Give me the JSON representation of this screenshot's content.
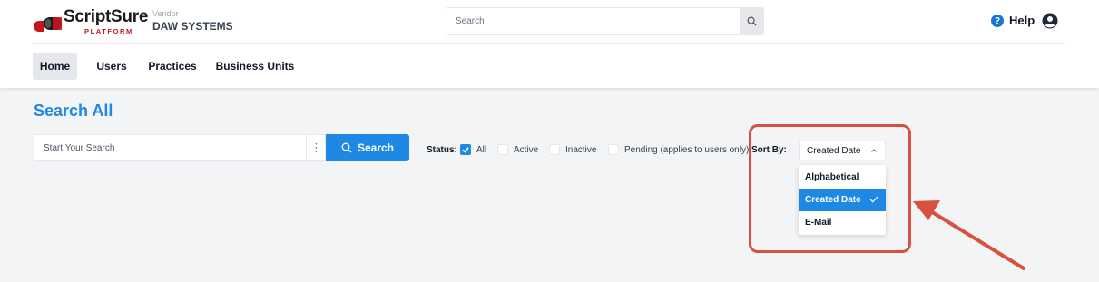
{
  "header": {
    "logo": {
      "text": "ScriptSure",
      "sub": "PLATFORM"
    },
    "vendor_label": "Vendor",
    "vendor_name": "DAW SYSTEMS",
    "search_placeholder": "Search",
    "help_label": "Help"
  },
  "nav": {
    "tabs": [
      {
        "label": "Home",
        "active": true
      },
      {
        "label": "Users",
        "active": false
      },
      {
        "label": "Practices",
        "active": false
      },
      {
        "label": "Business Units",
        "active": false
      }
    ]
  },
  "main": {
    "title": "Search All",
    "search_placeholder": "Start Your Search",
    "search_button": "Search",
    "status": {
      "label": "Status:",
      "options": [
        {
          "label": "All",
          "checked": true
        },
        {
          "label": "Active",
          "checked": false
        },
        {
          "label": "Inactive",
          "checked": false
        },
        {
          "label": "Pending (applies to users only)",
          "checked": false
        }
      ]
    },
    "sort": {
      "label": "Sort By:",
      "selected": "Created Date",
      "options": [
        "Alphabetical",
        "Created Date",
        "E-Mail"
      ]
    }
  },
  "colors": {
    "accent": "#1e88e5",
    "callout": "#d9503f",
    "brand_red": "#c4161c"
  }
}
